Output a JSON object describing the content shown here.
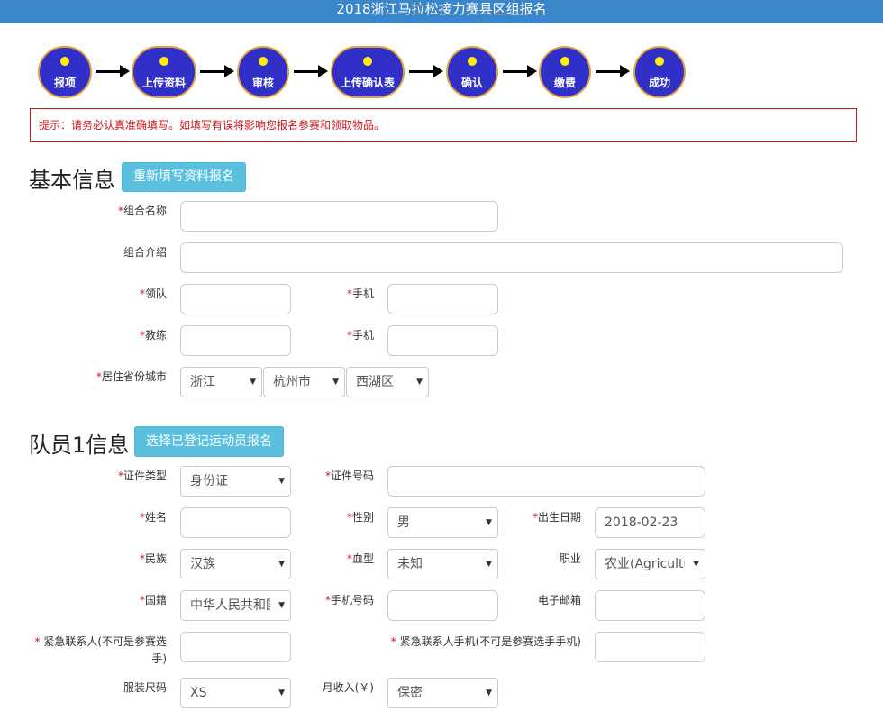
{
  "page_title": "2018浙江马拉松接力赛县区组报名",
  "steps": [
    "报项",
    "上传资料",
    "审核",
    "上传确认表",
    "确认",
    "缴费",
    "成功"
  ],
  "tip": "提示：请务必认真准确填写。如填写有误将影响您报名参赛和领取物品。",
  "basic": {
    "title": "基本信息",
    "refill_button": "重新填写资料报名",
    "group_name_label": "组合名称",
    "group_intro_label": "组合介绍",
    "leader_label": "领队",
    "leader_phone_label": "手机",
    "coach_label": "教练",
    "coach_phone_label": "手机",
    "residence_label": "居住省份城市",
    "province": "浙江",
    "city": "杭州市",
    "district": "西湖区"
  },
  "member1": {
    "title": "队员1信息",
    "select_button": "选择已登记运动员报名",
    "id_type_label": "证件类型",
    "id_type": "身份证",
    "id_number_label": "证件号码",
    "name_label": "姓名",
    "gender_label": "性别",
    "gender": "男",
    "birth_label": "出生日期",
    "birth": "2018-02-23",
    "ethnicity_label": "民族",
    "ethnicity": "汉族",
    "blood_label": "血型",
    "blood": "未知",
    "job_label": "职业",
    "job": "农业(Agriculture)",
    "nationality_label": "国籍",
    "nationality": "中华人民共和国",
    "mobile_label": "手机号码",
    "email_label": "电子邮箱",
    "emergency_contact_label": "紧急联系人(不可是参赛选手)",
    "emergency_phone_label": "紧急联系人手机(不可是参赛选手手机)",
    "size_label": "服装尺码",
    "size": "XS",
    "income_label": "月收入(￥)",
    "income": "保密"
  }
}
